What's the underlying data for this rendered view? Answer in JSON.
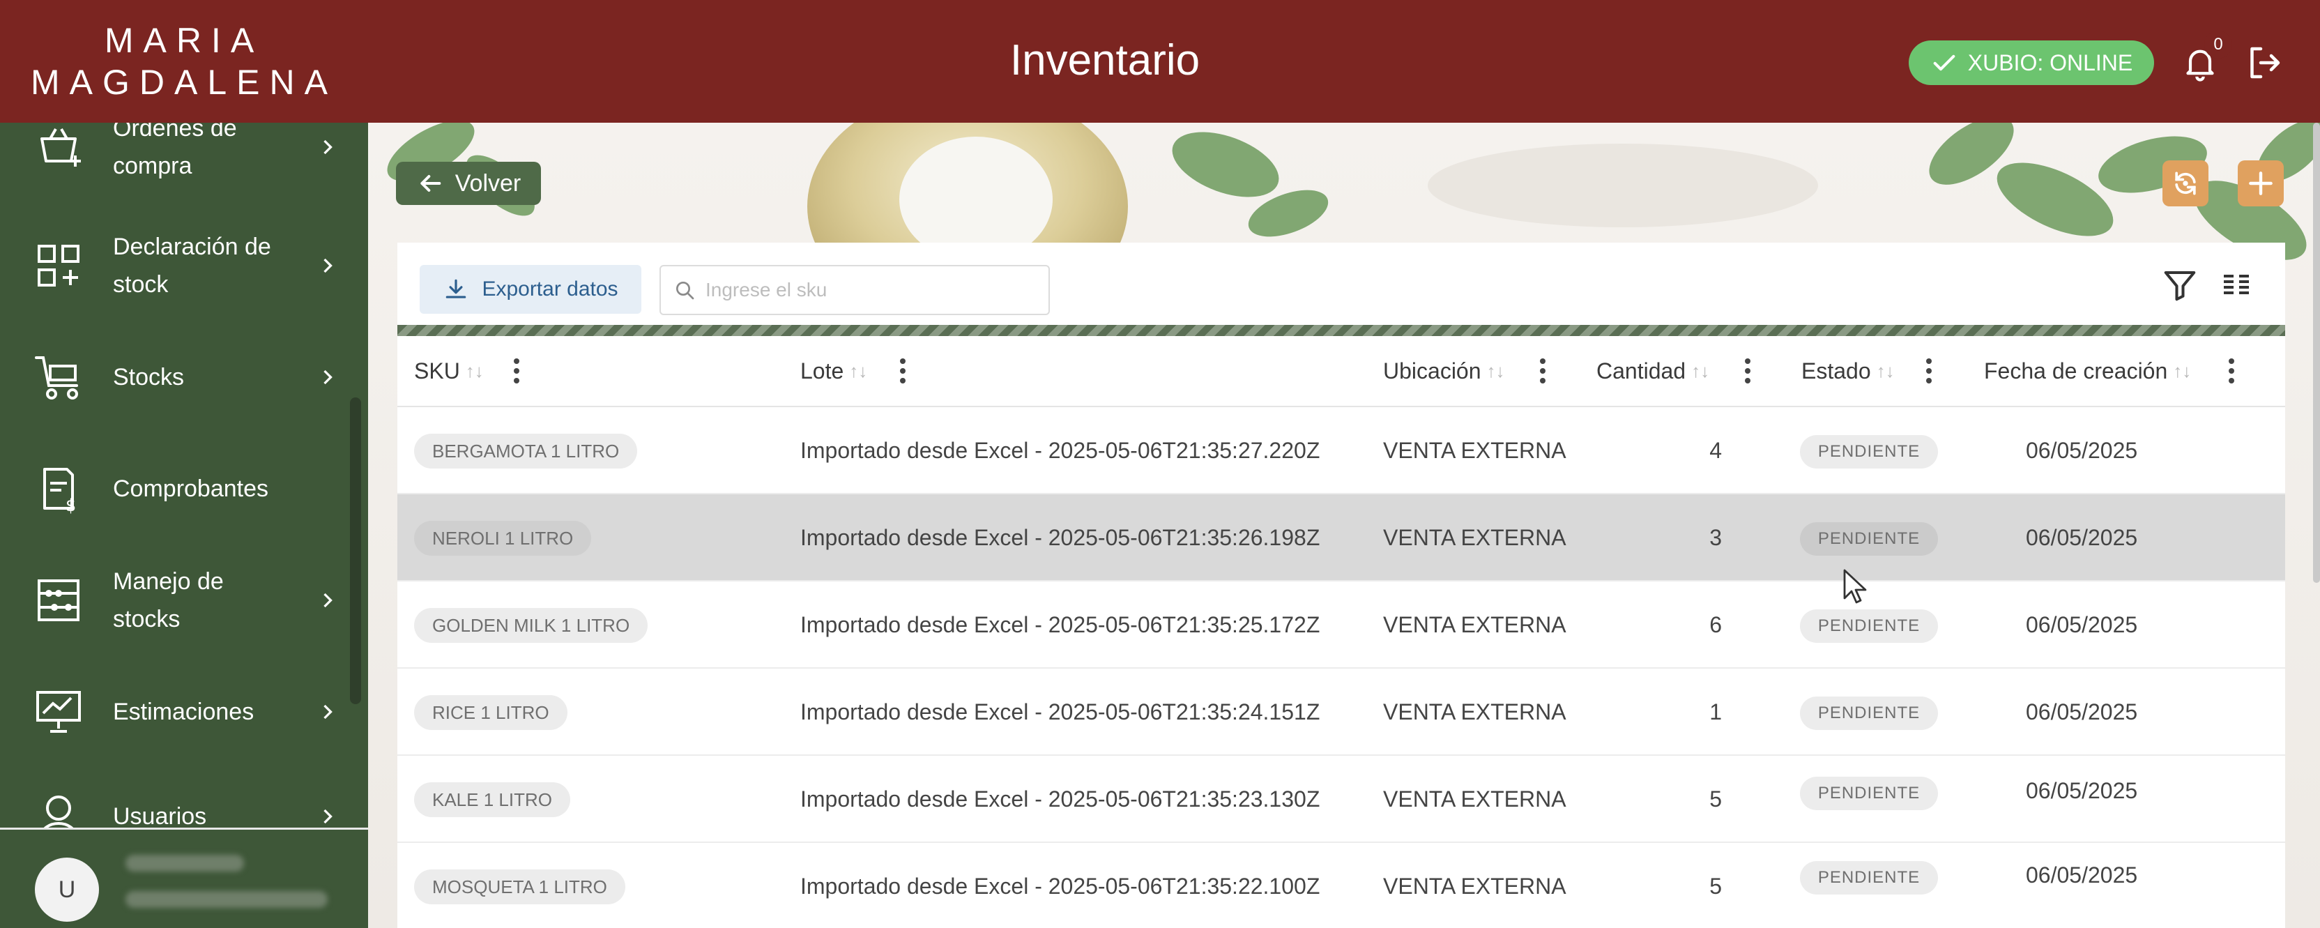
{
  "header": {
    "brand_line1": "MARIA",
    "brand_line2": "MAGDALENA",
    "title": "Inventario",
    "status_label": "XUBIO: ONLINE",
    "notification_count": "0",
    "colors": {
      "header_bg": "#7b2521",
      "status_green": "#6cc46f"
    }
  },
  "sidebar": {
    "items": [
      {
        "label": "Órdenes de compra",
        "icon": "cart-plus-icon"
      },
      {
        "label": "Declaración de stock",
        "icon": "grid-plus-icon"
      },
      {
        "label": "Stocks",
        "icon": "trolley-icon"
      },
      {
        "label": "Comprobantes",
        "icon": "receipt-icon"
      },
      {
        "label": "Manejo de stocks",
        "icon": "abacus-icon"
      },
      {
        "label": "Estimaciones",
        "icon": "chart-presentation-icon"
      },
      {
        "label": "Usuarios",
        "icon": "user-icon"
      }
    ],
    "user_initial": "U",
    "colors": {
      "bg": "#3e5738"
    }
  },
  "actions": {
    "back_label": "Volver"
  },
  "toolbar": {
    "export_label": "Exportar datos",
    "search_placeholder": "Ingrese el sku"
  },
  "table": {
    "columns": [
      "SKU",
      "Lote",
      "Ubicación",
      "Cantidad",
      "Estado",
      "Fecha de creación"
    ],
    "sort_glyph": "↑↓",
    "rows": [
      {
        "sku": "BERGAMOTA 1 LITRO",
        "lote": "Importado desde Excel - 2025-05-06T21:35:27.220Z",
        "ubicacion": "VENTA EXTERNA",
        "cantidad": "4",
        "estado": "PENDIENTE",
        "fecha": "06/05/2025"
      },
      {
        "sku": "NEROLI 1 LITRO",
        "lote": "Importado desde Excel - 2025-05-06T21:35:26.198Z",
        "ubicacion": "VENTA EXTERNA",
        "cantidad": "3",
        "estado": "PENDIENTE",
        "fecha": "06/05/2025"
      },
      {
        "sku": "GOLDEN MILK 1 LITRO",
        "lote": "Importado desde Excel - 2025-05-06T21:35:25.172Z",
        "ubicacion": "VENTA EXTERNA",
        "cantidad": "6",
        "estado": "PENDIENTE",
        "fecha": "06/05/2025"
      },
      {
        "sku": "RICE 1 LITRO",
        "lote": "Importado desde Excel - 2025-05-06T21:35:24.151Z",
        "ubicacion": "VENTA EXTERNA",
        "cantidad": "1",
        "estado": "PENDIENTE",
        "fecha": "06/05/2025"
      },
      {
        "sku": "KALE 1 LITRO",
        "lote": "Importado desde Excel - 2025-05-06T21:35:23.130Z",
        "ubicacion": "VENTA EXTERNA",
        "cantidad": "5",
        "estado": "PENDIENTE",
        "fecha": "06/05/2025"
      },
      {
        "sku": "MOSQUETA 1 LITRO",
        "lote": "Importado desde Excel - 2025-05-06T21:35:22.100Z",
        "ubicacion": "VENTA EXTERNA",
        "cantidad": "5",
        "estado": "PENDIENTE",
        "fecha": "06/05/2025"
      }
    ]
  }
}
